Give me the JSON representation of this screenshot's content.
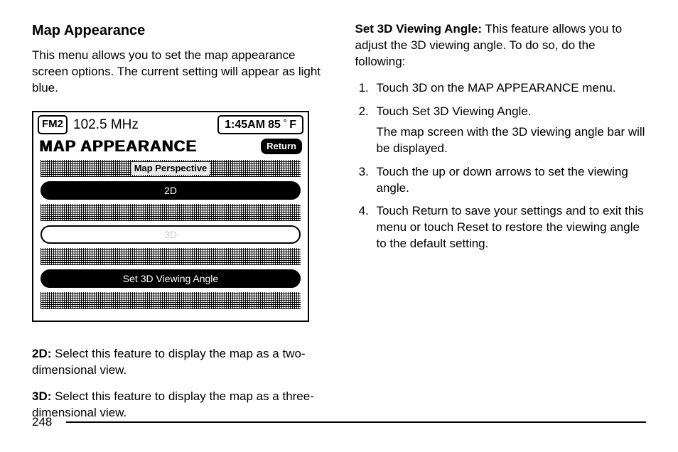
{
  "left": {
    "heading": "Map Appearance",
    "intro": "This menu allows you to set the map appearance screen options. The current setting will appear as light blue.",
    "screen": {
      "fm_band": "FM2",
      "frequency": "102.5 MHz",
      "clock": "1:45AM",
      "temp_value": "85",
      "temp_unit": "F",
      "title": "MAP APPEARANCE",
      "return": "Return",
      "perspective_label": "Map Perspective",
      "option_2d": "2D",
      "option_3d": "3D",
      "option_set_angle": "Set 3D Viewing Angle"
    },
    "desc_2d_label": "2D:",
    "desc_2d_text": " Select this feature to display the map as a two-dimensional view.",
    "desc_3d_label": "3D:",
    "desc_3d_text": " Select this feature to display the map as a three-dimensional view."
  },
  "right": {
    "lead_label": "Set 3D Viewing Angle:",
    "lead_text": " This feature allows you to adjust the 3D viewing angle. To do so, do the following:",
    "steps": [
      {
        "main": "Touch 3D on the MAP APPEARANCE menu."
      },
      {
        "main": "Touch Set 3D Viewing Angle.",
        "sub": "The map screen with the 3D viewing angle bar will be displayed."
      },
      {
        "main": "Touch the up or down arrows to set the viewing angle."
      },
      {
        "main": "Touch Return to save your settings and to exit this menu or touch Reset to restore the viewing angle to the default setting."
      }
    ]
  },
  "page_number": "248"
}
